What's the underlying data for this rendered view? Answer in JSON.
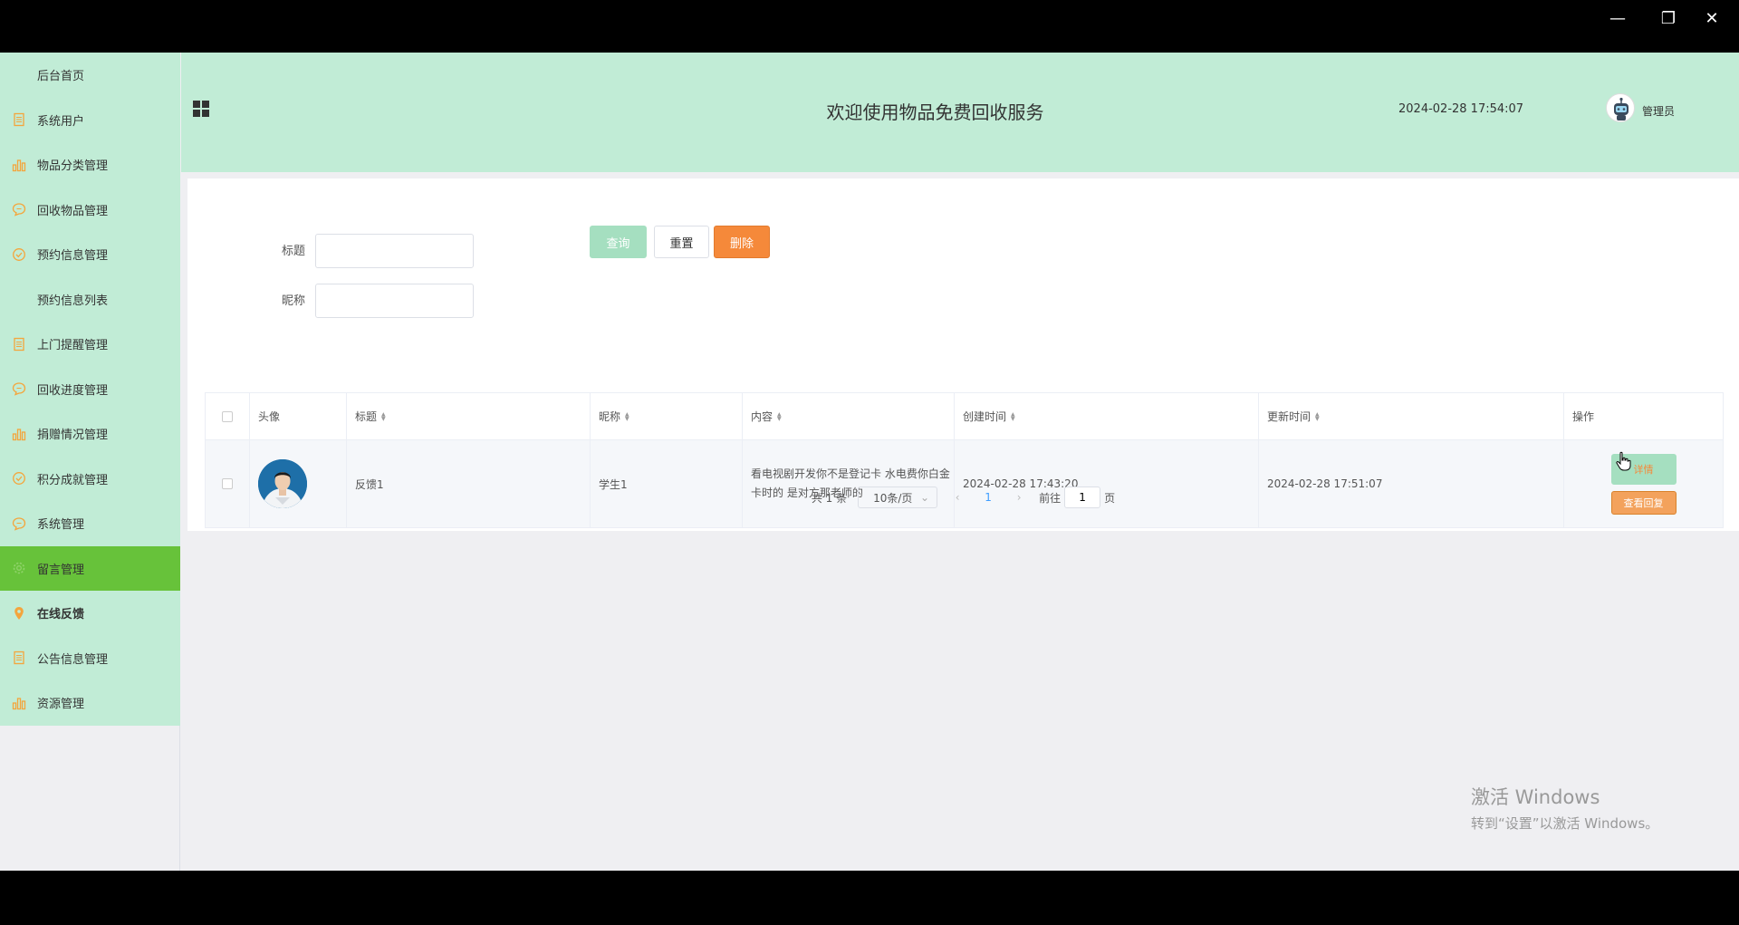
{
  "window_controls": {
    "minimize": "—",
    "restore": "❐",
    "close": "✕"
  },
  "sidebar": {
    "items": [
      {
        "label": "后台首页",
        "icon": "none"
      },
      {
        "label": "系统用户",
        "icon": "document-icon"
      },
      {
        "label": "物品分类管理",
        "icon": "bar-chart-icon"
      },
      {
        "label": "回收物品管理",
        "icon": "chat-bubble-icon"
      },
      {
        "label": "预约信息管理",
        "icon": "check-circle-icon"
      },
      {
        "label": "预约信息列表",
        "icon": "none"
      },
      {
        "label": "上门提醒管理",
        "icon": "document-icon"
      },
      {
        "label": "回收进度管理",
        "icon": "chat-bubble-icon"
      },
      {
        "label": "捐赠情况管理",
        "icon": "bar-chart-icon"
      },
      {
        "label": "积分成就管理",
        "icon": "check-circle-icon"
      },
      {
        "label": "系统管理",
        "icon": "chat-bubble-icon"
      },
      {
        "label": "留言管理",
        "icon": "gear-icon"
      },
      {
        "label": "在线反馈",
        "icon": "location-pin-icon"
      },
      {
        "label": "公告信息管理",
        "icon": "document-icon"
      },
      {
        "label": "资源管理",
        "icon": "bar-chart-icon"
      }
    ]
  },
  "header": {
    "title": "欢迎使用物品免费回收服务",
    "datetime": "2024-02-28 17:54:07",
    "user": "管理员"
  },
  "search": {
    "title_label": "标题",
    "title_value": "",
    "nickname_label": "昵称",
    "nickname_value": "",
    "query_button": "查询",
    "reset_button": "重置",
    "delete_button": "删除"
  },
  "table": {
    "columns": [
      "头像",
      "标题",
      "昵称",
      "内容",
      "创建时间",
      "更新时间",
      "操作"
    ],
    "rows": [
      {
        "title": "反馈1",
        "nickname": "学生1",
        "content": "看电视剧开发你不是登记卡 水电费你白金卡时的 是对方那老师的",
        "created": "2024-02-28 17:43:20",
        "updated": "2024-02-28 17:51:07",
        "detail_button": "详情",
        "reply_button": "查看回复"
      }
    ]
  },
  "pagination": {
    "total": "共 1 条",
    "page_size": "10条/页",
    "current_page": "1",
    "goto_label": "前往",
    "goto_value": "1",
    "page_unit": "页"
  },
  "watermark": {
    "line1": "激活 Windows",
    "line2": "转到“设置”以激活 Windows。"
  },
  "colors": {
    "mint": "#c1ecd6",
    "active_green": "#67c23a",
    "orange": "#f5893a",
    "icon_orange": "#f4a53c"
  }
}
